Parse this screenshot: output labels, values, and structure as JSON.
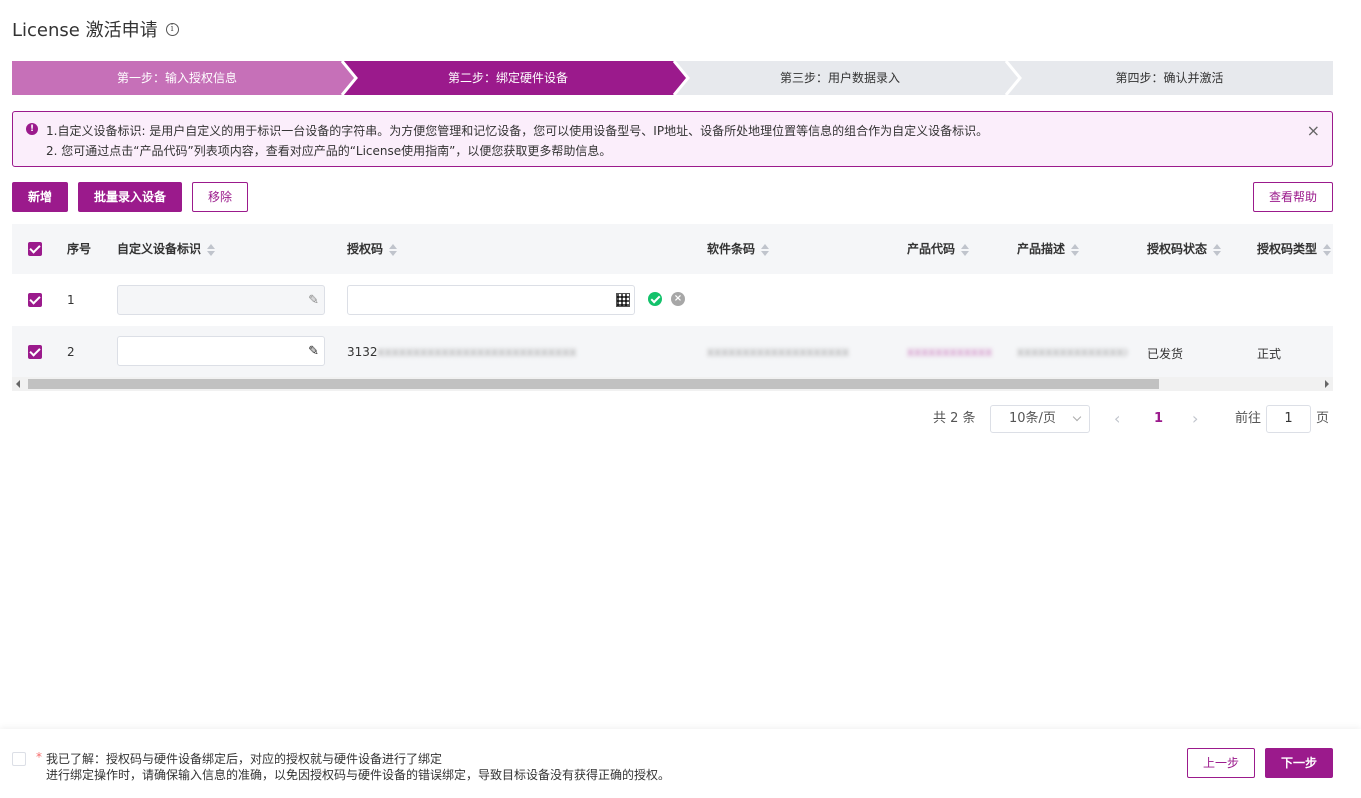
{
  "page": {
    "title": "License 激活申请",
    "info_icon": "info-icon"
  },
  "steps": [
    {
      "label": "第一步：输入授权信息",
      "state": "done",
      "color": "#c670b8"
    },
    {
      "label": "第二步：绑定硬件设备",
      "state": "active",
      "color": "#9b1a8c"
    },
    {
      "label": "第三步：用户数据录入",
      "state": "pending",
      "color": "#e7e9ed"
    },
    {
      "label": "第四步：确认并激活",
      "state": "pending",
      "color": "#e7e9ed"
    }
  ],
  "alert": {
    "line1": "1.自定义设备标识: 是用户自定义的用于标识一台设备的字符串。为方便您管理和记忆设备，您可以使用设备型号、IP地址、设备所处地理位置等信息的组合作为自定义设备标识。",
    "line2": "2. 您可通过点击“产品代码”列表项内容，查看对应产品的“License使用指南”，以便您获取更多帮助信息。",
    "close": "×"
  },
  "toolbar": {
    "add": "新增",
    "batch": "批量录入设备",
    "remove": "移除",
    "help": "查看帮助"
  },
  "table": {
    "columns": [
      "序号",
      "自定义设备标识",
      "授权码",
      "软件条码",
      "产品代码",
      "产品描述",
      "授权码状态",
      "授权码类型"
    ],
    "rows": [
      {
        "index": "1",
        "device_id": "",
        "license_code": "",
        "barcode": "",
        "product_code": "",
        "product_desc": "",
        "status": "",
        "type": ""
      },
      {
        "index": "2",
        "device_id": "",
        "license_code": "3132",
        "license_code_hidden": "xxxxxxxxxxxxxxxxxxxxxxxxxxxx",
        "barcode": "xxxxxxxxxxxxxxxxxxxx",
        "product_code": "xxxxxxxxxxxx",
        "product_desc": "xxxxxxxxxxxxxxxx",
        "status": "已发货",
        "type": "正式"
      }
    ]
  },
  "pagination": {
    "total": "共 2 条",
    "page_size": "10条/页",
    "current": "1",
    "goto_label": "前往",
    "goto_value": "1",
    "page_unit": "页",
    "prev": "‹",
    "next": "›"
  },
  "footer": {
    "required": "*",
    "line1": "我已了解：授权码与硬件设备绑定后，对应的授权就与硬件设备进行了绑定",
    "line2": "进行绑定操作时，请确保输入信息的准确，以免因授权码与硬件设备的错误绑定，导致目标设备没有获得正确的授权。",
    "prev": "上一步",
    "next": "下一步"
  }
}
